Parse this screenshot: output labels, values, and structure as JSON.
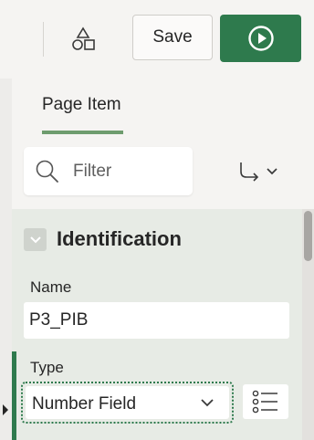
{
  "toolbar": {
    "shapes_icon": "shapes-icon",
    "save_label": "Save",
    "run_icon": "play-circle-icon",
    "run_color": "#2e7a4d"
  },
  "tabs": [
    {
      "label": "Page Item",
      "active": true
    }
  ],
  "filter": {
    "placeholder": "Filter",
    "value": "",
    "icon": "search-icon"
  },
  "goto": {
    "icon": "go-to-arrow-icon",
    "chevron_icon": "chevron-down-icon"
  },
  "section": {
    "title": "Identification",
    "collapse_icon": "chevron-down-icon",
    "fields": {
      "name": {
        "label": "Name",
        "value": "P3_PIB"
      },
      "type": {
        "label": "Type",
        "value": "Number Field"
      }
    }
  },
  "colors": {
    "accent": "#2e7a4d",
    "section_background": "#e7ebe5",
    "tab_underline": "#6e9c6e"
  }
}
